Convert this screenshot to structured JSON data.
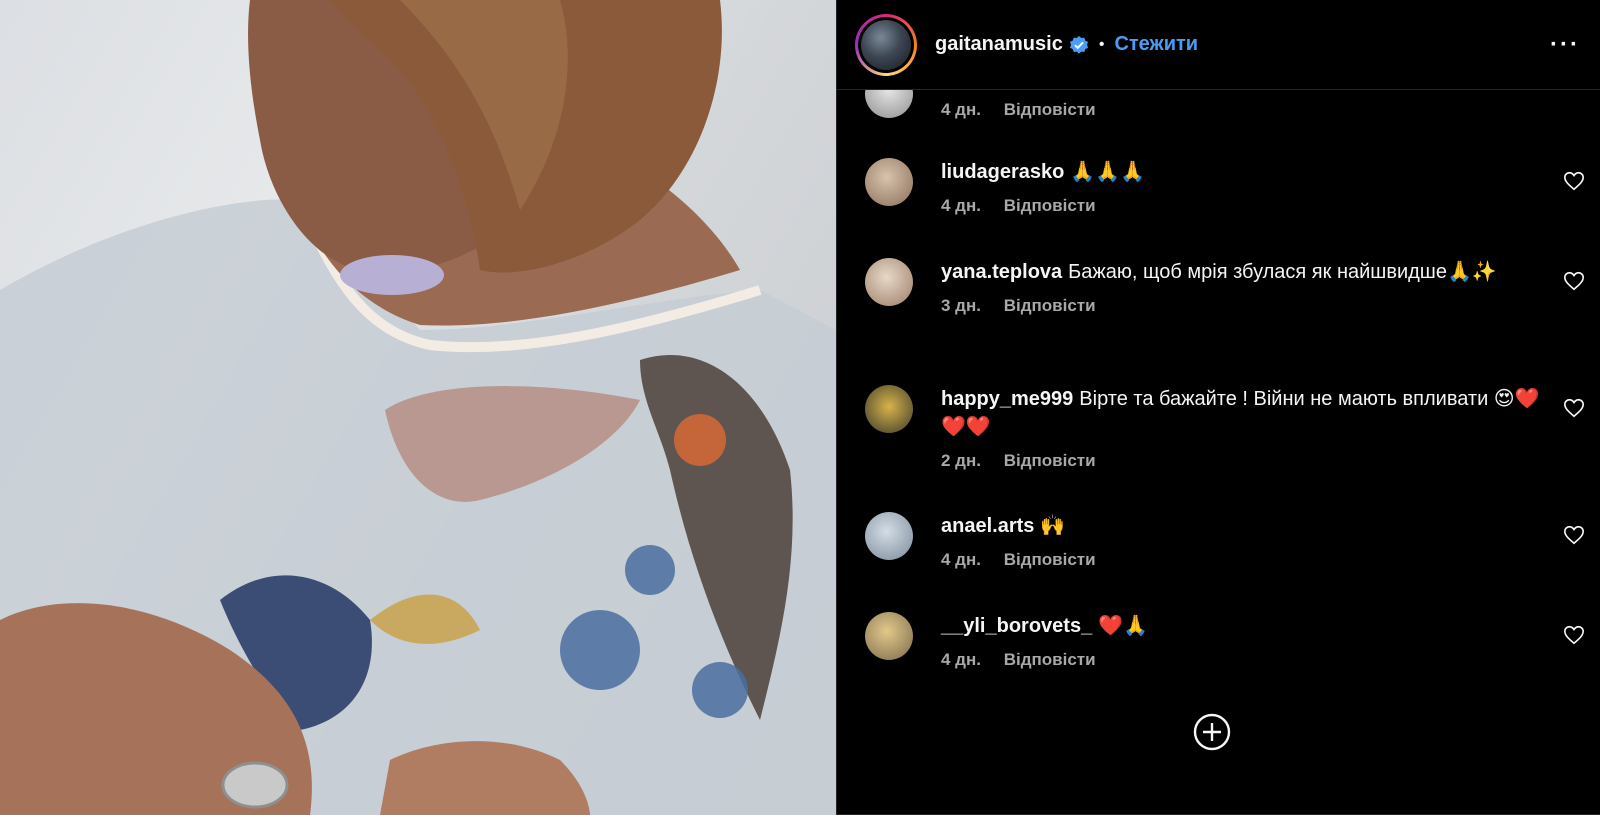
{
  "header": {
    "username": "gaitanamusic",
    "separator": "•",
    "follow_label": "Стежити",
    "more_label": "···"
  },
  "comments": [
    {
      "username": "",
      "text": "",
      "time": "4 дн.",
      "reply": "Відповісти"
    },
    {
      "username": "liudagerasko",
      "text": "🙏🙏🙏",
      "time": "4 дн.",
      "reply": "Відповісти"
    },
    {
      "username": "yana.teplova",
      "text": "Бажаю, щоб мрія збулася як найшвидше🙏✨",
      "time": "3 дн.",
      "reply": "Відповісти"
    },
    {
      "username": "happy_me999",
      "text": "Вірте та бажайте ! Війни не мають впливати 😍❤️❤️❤️",
      "time": "2 дн.",
      "reply": "Відповісти"
    },
    {
      "username": "anael.arts",
      "text": "🙌",
      "time": "4 дн.",
      "reply": "Відповісти"
    },
    {
      "username": "__yli_borovets_",
      "text": "❤️🙏",
      "time": "4 дн.",
      "reply": "Відповісти"
    }
  ],
  "colors": {
    "accent": "#4a9df6",
    "meta": "#a8a8a8",
    "background": "#000000"
  },
  "icons": [
    "verified-icon",
    "more-icon",
    "heart-icon",
    "add-circle-icon"
  ]
}
